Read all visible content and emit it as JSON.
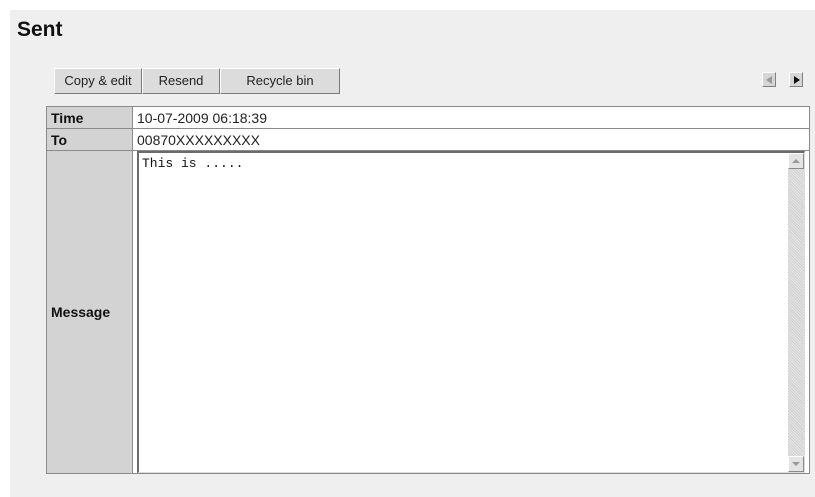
{
  "page": {
    "title": "Sent"
  },
  "toolbar": {
    "copy_edit_label": "Copy & edit",
    "resend_label": "Resend",
    "recycle_bin_label": "Recycle bin"
  },
  "nav": {
    "prev_icon": "triangle-left-icon",
    "next_icon": "triangle-right-icon"
  },
  "details": {
    "time_label": "Time",
    "time_value": "10-07-2009 06:18:39",
    "to_label": "To",
    "to_value": "00870XXXXXXXXX",
    "message_label": "Message",
    "message_value": "This is ....."
  },
  "colors": {
    "panel_bg": "#efefef",
    "label_bg": "#d3d3d3",
    "button_bg": "#dcdcdc"
  }
}
